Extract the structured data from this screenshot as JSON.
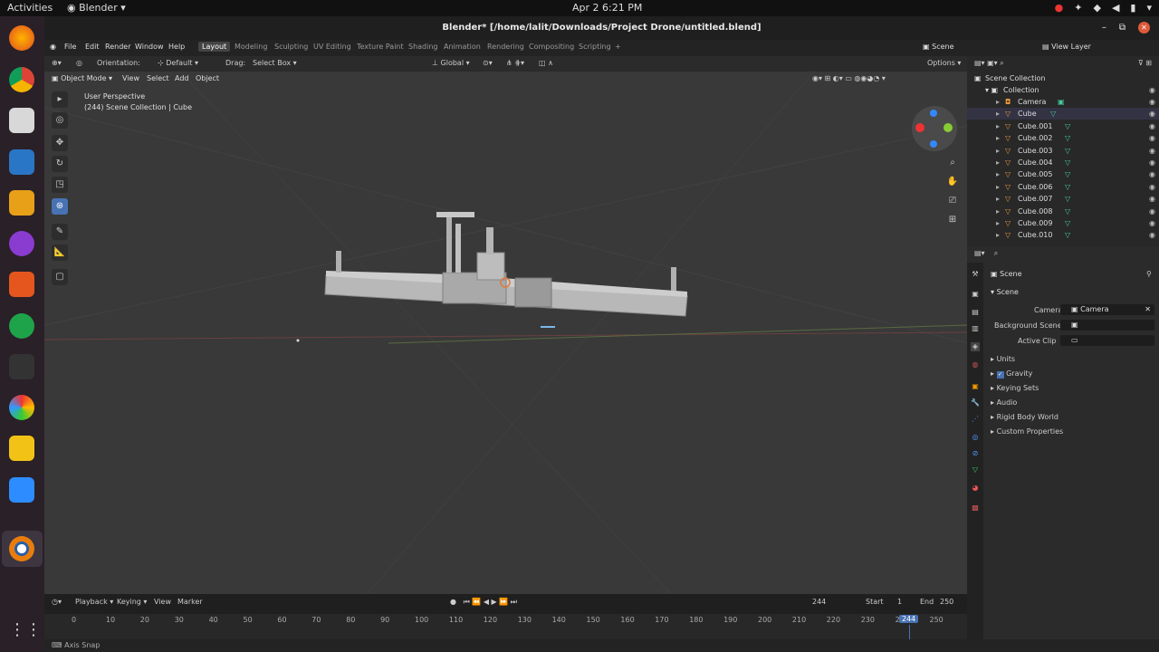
{
  "system": {
    "activities": "Activities",
    "app_name": "Blender",
    "clock": "Apr 2   6:21 PM"
  },
  "window": {
    "title": "Blender* [/home/lalit/Downloads/Project Drone/untitled.blend]"
  },
  "menu": [
    "File",
    "Edit",
    "Render",
    "Window",
    "Help"
  ],
  "workspaces": [
    "Layout",
    "Modeling",
    "Sculpting",
    "UV Editing",
    "Texture Paint",
    "Shading",
    "Animation",
    "Rendering",
    "Compositing",
    "Scripting"
  ],
  "top_right": {
    "scene": "Scene",
    "view_layer": "View Layer"
  },
  "viewport_header": {
    "orientation_label": "Orientation:",
    "orientation_value": "Default",
    "drag_label": "Drag:",
    "drag_value": "Select Box",
    "transform": "Global",
    "options": "Options",
    "mode": "Object Mode",
    "view": "View",
    "select": "Select",
    "add": "Add",
    "object": "Object"
  },
  "viewport_info": {
    "line1": "User Perspective",
    "line2": "(244) Scene Collection | Cube"
  },
  "outliner": {
    "root": "Scene Collection",
    "collection": "Collection",
    "items": [
      "Camera",
      "Cube",
      "Cube.001",
      "Cube.002",
      "Cube.003",
      "Cube.004",
      "Cube.005",
      "Cube.006",
      "Cube.007",
      "Cube.008",
      "Cube.009",
      "Cube.010"
    ]
  },
  "properties": {
    "header": "Scene",
    "panel": "Scene",
    "camera_label": "Camera",
    "camera_value": "Camera",
    "bg_label": "Background Scene",
    "clip_label": "Active Clip",
    "sections": [
      "Units",
      "Gravity",
      "Keying Sets",
      "Audio",
      "Rigid Body World",
      "Custom Properties"
    ]
  },
  "timeline": {
    "playback": "Playback",
    "keying": "Keying",
    "view": "View",
    "marker": "Marker",
    "current_frame": "244",
    "start_label": "Start",
    "start": "1",
    "end_label": "End",
    "end": "250",
    "ticks": [
      "0",
      "10",
      "20",
      "30",
      "40",
      "50",
      "60",
      "70",
      "80",
      "90",
      "100",
      "110",
      "120",
      "130",
      "140",
      "150",
      "160",
      "170",
      "180",
      "190",
      "200",
      "210",
      "220",
      "230",
      "240",
      "250"
    ]
  },
  "status": {
    "hint": "Axis Snap"
  }
}
